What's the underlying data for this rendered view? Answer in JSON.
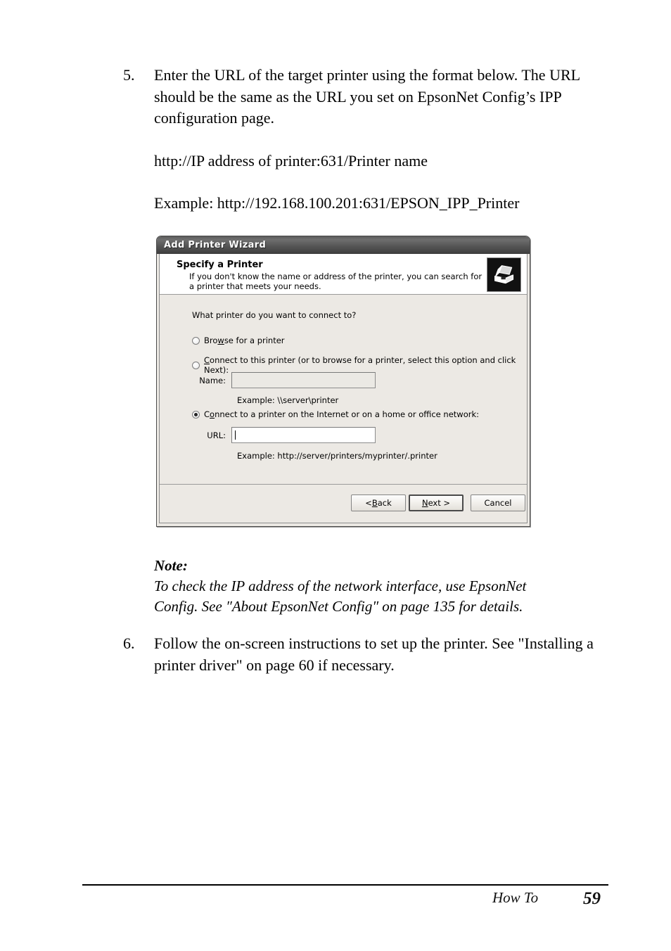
{
  "document": {
    "steps": [
      {
        "number": "5.",
        "paragraphs": [
          "Enter the URL of the target printer using the format below. The URL should be the same as the URL you set on EpsonNet Config’s IPP configuration page.",
          "http://IP address of printer:631/Printer name",
          "Example: http://192.168.100.201:631/EPSON_IPP_Printer"
        ]
      },
      {
        "number": "6.",
        "paragraphs": [
          "Follow the on-screen instructions to set up the printer. See \"Installing a printer driver\" on page 60 if necessary."
        ]
      }
    ],
    "note": {
      "title": "Note:",
      "line1": "To check the IP address of the network interface, use EpsonNet",
      "line2": "Config. See  ″About EpsonNet Config″ on page 135 for details."
    },
    "footer": {
      "section": "How To",
      "page_number": "59"
    }
  },
  "dialog": {
    "title": "Add Printer Wizard",
    "header": {
      "title": "Specify a Printer",
      "description": "If you don't know the name or address of the printer, you can search for a printer that meets your needs.",
      "icon": "printer-icon"
    },
    "question": "What printer do you want to connect to?",
    "options": [
      {
        "id": "browse-for-printer",
        "label_pre": "Bro",
        "label_accel": "w",
        "label_post": "se for a printer",
        "selected": false
      },
      {
        "id": "connect-to-this-printer",
        "label_pre": "",
        "label_accel": "C",
        "label_post": "onnect to this printer (or to browse for a printer, select this option and click Next):",
        "selected": false
      },
      {
        "id": "connect-internet-printer",
        "label_pre": "C",
        "label_accel": "o",
        "label_post": "nnect to a printer on the Internet or on a home or office network:",
        "selected": true
      }
    ],
    "name_field": {
      "label": "Name:",
      "value": "",
      "enabled": false,
      "example": "Example: \\\\server\\printer"
    },
    "url_field": {
      "label": "URL:",
      "value": "",
      "enabled": true,
      "example": "Example: http://server/printers/myprinter/.printer"
    },
    "buttons": [
      {
        "id": "back",
        "pre": "< ",
        "accel": "B",
        "post": "ack",
        "default": false
      },
      {
        "id": "next",
        "pre": "",
        "accel": "N",
        "post": "ext >",
        "default": true
      },
      {
        "id": "cancel",
        "pre": "",
        "accel": "",
        "post": "Cancel",
        "default": false
      }
    ]
  }
}
